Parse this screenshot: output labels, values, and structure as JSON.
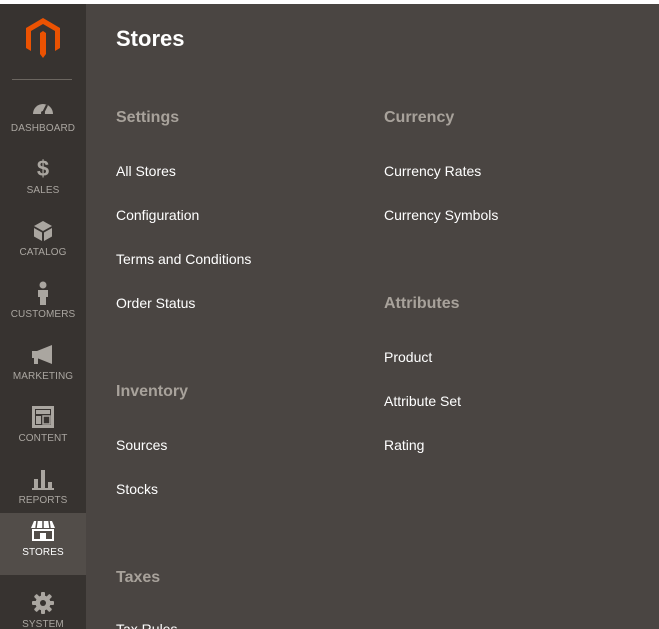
{
  "sidebar": {
    "logo_icon": "magento-logo-icon",
    "items": [
      {
        "key": "dashboard",
        "label": "DASHBOARD",
        "icon": "speedometer-icon"
      },
      {
        "key": "sales",
        "label": "SALES",
        "icon": "dollar-icon"
      },
      {
        "key": "catalog",
        "label": "CATALOG",
        "icon": "box-icon"
      },
      {
        "key": "customers",
        "label": "CUSTOMERS",
        "icon": "person-icon"
      },
      {
        "key": "marketing",
        "label": "MARKETING",
        "icon": "megaphone-icon"
      },
      {
        "key": "content",
        "label": "CONTENT",
        "icon": "layout-icon"
      },
      {
        "key": "reports",
        "label": "REPORTS",
        "icon": "bar-chart-icon"
      },
      {
        "key": "stores",
        "label": "STORES",
        "icon": "storefront-icon",
        "active": true
      },
      {
        "key": "system",
        "label": "SYSTEM",
        "icon": "gear-icon"
      }
    ]
  },
  "panel": {
    "title": "Stores",
    "sections": {
      "settings": {
        "title": "Settings",
        "links": [
          "All Stores",
          "Configuration",
          "Terms and Conditions",
          "Order Status"
        ]
      },
      "inventory": {
        "title": "Inventory",
        "links": [
          "Sources",
          "Stocks"
        ]
      },
      "taxes": {
        "title": "Taxes",
        "links": [
          "Tax Rules"
        ]
      },
      "currency": {
        "title": "Currency",
        "links": [
          "Currency Rates",
          "Currency Symbols"
        ]
      },
      "attributes": {
        "title": "Attributes",
        "links": [
          "Product",
          "Attribute Set",
          "Rating"
        ]
      }
    }
  },
  "colors": {
    "sidebar_bg": "#373330",
    "sidebar_active_bg": "#524d49",
    "panel_bg": "#4a4542",
    "section_title": "#a8a29b",
    "logo_orange": "#eb5202"
  }
}
